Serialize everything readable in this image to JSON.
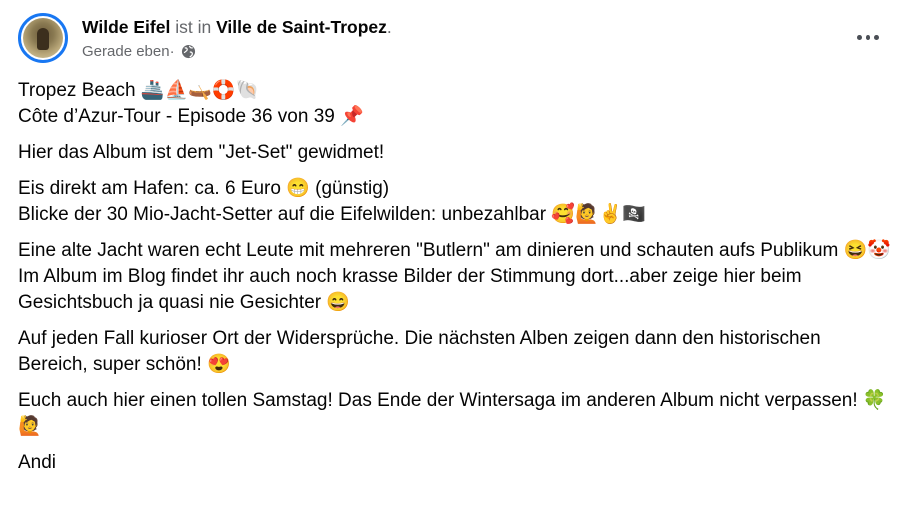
{
  "author": {
    "name": "Wilde Eifel",
    "connector": " ist in ",
    "place": "Ville de Saint-Tropez",
    "period": "."
  },
  "meta": {
    "time": "Gerade eben",
    "separator": " · ",
    "privacy_icon": "globe-icon"
  },
  "actions": {
    "more_icon": "more-options-icon"
  },
  "post": {
    "p1": "Tropez Beach 🚢⛵🛶🛟🐚\nCôte d’Azur-Tour - Episode 36 von 39 📌",
    "p2": "Hier das Album ist dem \"Jet-Set\" gewidmet!",
    "p3": "Eis direkt am Hafen: ca. 6 Euro 😁 (günstig)\nBlicke der 30 Mio-Jacht-Setter auf die Eifelwilden: unbezahlbar 🥰🙋✌🏴‍☠️",
    "p4": "Eine alte Jacht waren echt Leute mit mehreren \"Butlern\" am dinieren und schauten aufs Publikum 😆🤡\nIm Album im Blog findet ihr auch noch krasse Bilder der Stimmung dort...aber zeige hier beim Gesichtsbuch ja quasi nie Gesichter 😄",
    "p5": "Auf jeden Fall kurioser Ort der Widersprüche. Die nächsten Alben zeigen dann den historischen Bereich, super schön! 😍",
    "p6": "Euch auch hier einen tollen Samstag! Das Ende der Wintersaga im anderen Album nicht verpassen! 🍀🙋",
    "p7": "Andi"
  }
}
